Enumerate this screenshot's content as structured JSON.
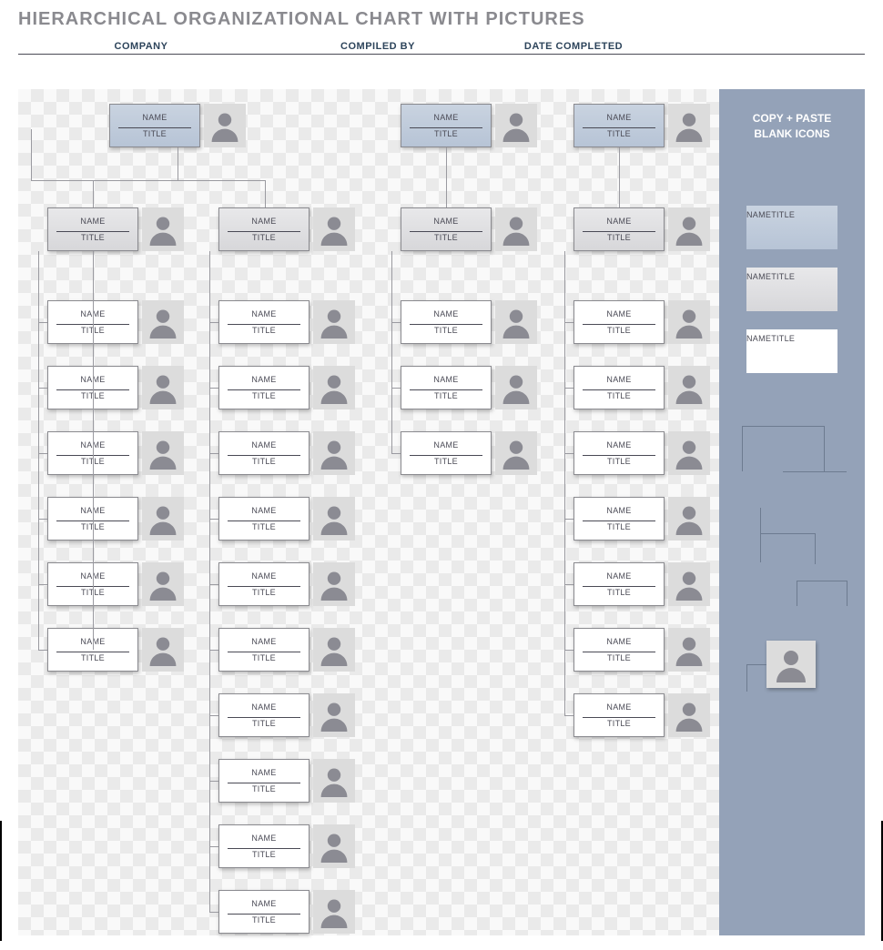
{
  "heading": "HIERARCHICAL ORGANIZATIONAL CHART WITH PICTURES",
  "header": {
    "company": "COMPANY",
    "compiled_by": "COMPILED BY",
    "date_completed": "DATE COMPLETED"
  },
  "labels": {
    "name": "NAME",
    "title": "TITLE"
  },
  "sidepanel": {
    "title_line1": "COPY + PASTE",
    "title_line2": "BLANK ICONS",
    "blank_blue": {
      "name": "NAME",
      "title": "TITLE"
    },
    "blank_grey": {
      "name": "NAME",
      "title": "TITLE"
    },
    "blank_white": {
      "name": "NAME",
      "title": "TITLE"
    }
  },
  "tree": {
    "roots": [
      {
        "id": "r1",
        "name": "NAME",
        "title": "TITLE",
        "style": "blue",
        "children": [
          {
            "id": "r1a",
            "name": "NAME",
            "title": "TITLE",
            "style": "grey",
            "children": [
              {
                "id": "r1a1",
                "name": "NAME",
                "title": "TITLE",
                "style": "white"
              },
              {
                "id": "r1a2",
                "name": "NAME",
                "title": "TITLE",
                "style": "white"
              },
              {
                "id": "r1a3",
                "name": "NAME",
                "title": "TITLE",
                "style": "white"
              },
              {
                "id": "r1a4",
                "name": "NAME",
                "title": "TITLE",
                "style": "white"
              },
              {
                "id": "r1a5",
                "name": "NAME",
                "title": "TITLE",
                "style": "white"
              },
              {
                "id": "r1a6",
                "name": "NAME",
                "title": "TITLE",
                "style": "white"
              }
            ]
          },
          {
            "id": "r1b",
            "name": "NAME",
            "title": "TITLE",
            "style": "grey",
            "children": [
              {
                "id": "r1b1",
                "name": "NAME",
                "title": "TITLE",
                "style": "white"
              },
              {
                "id": "r1b2",
                "name": "NAME",
                "title": "TITLE",
                "style": "white"
              },
              {
                "id": "r1b3",
                "name": "NAME",
                "title": "TITLE",
                "style": "white"
              },
              {
                "id": "r1b4",
                "name": "NAME",
                "title": "TITLE",
                "style": "white"
              },
              {
                "id": "r1b5",
                "name": "NAME",
                "title": "TITLE",
                "style": "white"
              },
              {
                "id": "r1b6",
                "name": "NAME",
                "title": "TITLE",
                "style": "white"
              },
              {
                "id": "r1b7",
                "name": "NAME",
                "title": "TITLE",
                "style": "white"
              },
              {
                "id": "r1b8",
                "name": "NAME",
                "title": "TITLE",
                "style": "white"
              },
              {
                "id": "r1b9",
                "name": "NAME",
                "title": "TITLE",
                "style": "white"
              },
              {
                "id": "r1b10",
                "name": "NAME",
                "title": "TITLE",
                "style": "white"
              }
            ]
          }
        ]
      },
      {
        "id": "r2",
        "name": "NAME",
        "title": "TITLE",
        "style": "blue",
        "children": [
          {
            "id": "r2a",
            "name": "NAME",
            "title": "TITLE",
            "style": "grey",
            "children": [
              {
                "id": "r2a1",
                "name": "NAME",
                "title": "TITLE",
                "style": "white"
              },
              {
                "id": "r2a2",
                "name": "NAME",
                "title": "TITLE",
                "style": "white"
              },
              {
                "id": "r2a3",
                "name": "NAME",
                "title": "TITLE",
                "style": "white"
              }
            ]
          }
        ]
      },
      {
        "id": "r3",
        "name": "NAME",
        "title": "TITLE",
        "style": "blue",
        "children": [
          {
            "id": "r3a",
            "name": "NAME",
            "title": "TITLE",
            "style": "grey",
            "children": [
              {
                "id": "r3a1",
                "name": "NAME",
                "title": "TITLE",
                "style": "white"
              },
              {
                "id": "r3a2",
                "name": "NAME",
                "title": "TITLE",
                "style": "white"
              },
              {
                "id": "r3a3",
                "name": "NAME",
                "title": "TITLE",
                "style": "white"
              },
              {
                "id": "r3a4",
                "name": "NAME",
                "title": "TITLE",
                "style": "white"
              },
              {
                "id": "r3a5",
                "name": "NAME",
                "title": "TITLE",
                "style": "white"
              },
              {
                "id": "r3a6",
                "name": "NAME",
                "title": "TITLE",
                "style": "white"
              },
              {
                "id": "r3a7",
                "name": "NAME",
                "title": "TITLE",
                "style": "white"
              }
            ]
          }
        ]
      }
    ]
  }
}
